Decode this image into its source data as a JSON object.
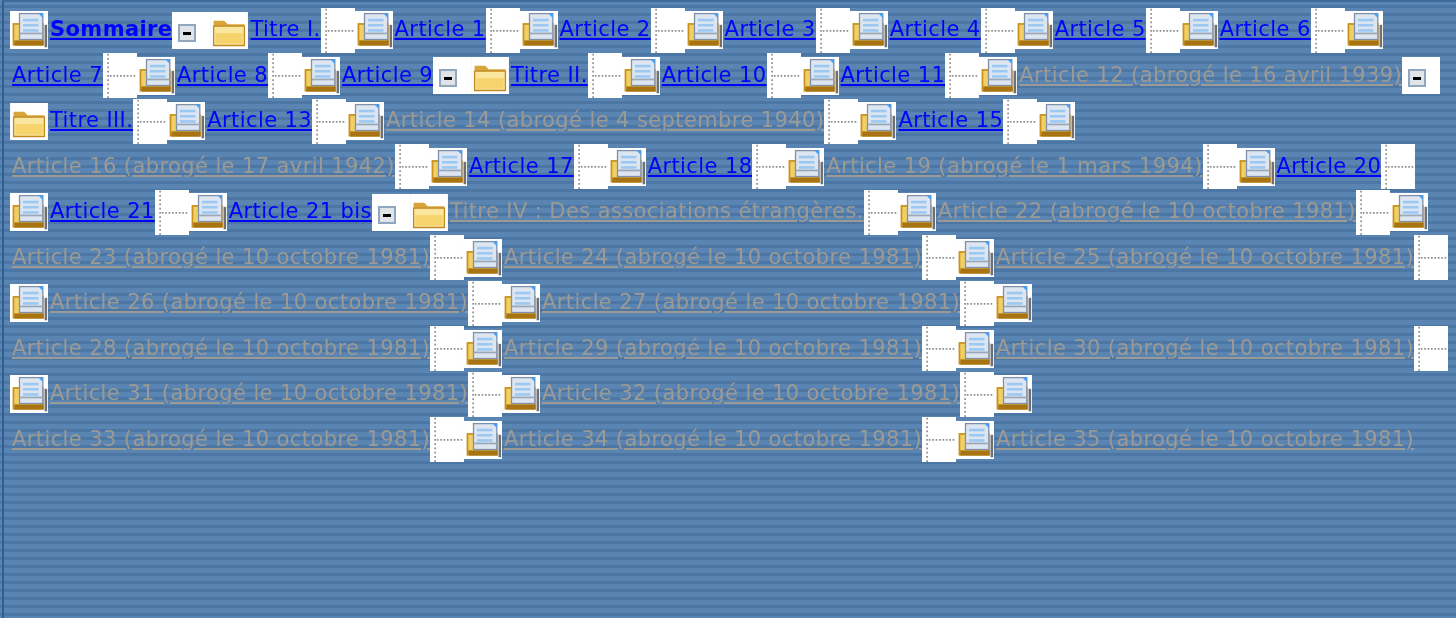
{
  "tree": [
    {
      "kind": "summary",
      "label": "Sommaire",
      "repealed": false
    },
    {
      "kind": "title",
      "label": "Titre I.",
      "repealed": false,
      "expanded": true,
      "children": [
        {
          "kind": "article",
          "label": "Article 1",
          "repealed": false
        },
        {
          "kind": "article",
          "label": "Article 2",
          "repealed": false
        },
        {
          "kind": "article",
          "label": "Article 3",
          "repealed": false
        },
        {
          "kind": "article",
          "label": "Article 4",
          "repealed": false
        },
        {
          "kind": "article",
          "label": "Article 5",
          "repealed": false
        },
        {
          "kind": "article",
          "label": "Article 6",
          "repealed": false
        },
        {
          "kind": "article",
          "label": "Article 7",
          "repealed": false
        },
        {
          "kind": "article",
          "label": "Article 8",
          "repealed": false
        },
        {
          "kind": "article",
          "label": "Article 9",
          "repealed": false
        }
      ]
    },
    {
      "kind": "title",
      "label": "Titre II.",
      "repealed": false,
      "expanded": true,
      "children": [
        {
          "kind": "article",
          "label": "Article 10",
          "repealed": false
        },
        {
          "kind": "article",
          "label": "Article 11",
          "repealed": false
        },
        {
          "kind": "article",
          "label": "Article 12 (abrogé le 16 avril 1939)",
          "repealed": true
        }
      ]
    },
    {
      "kind": "title",
      "label": "Titre III.",
      "repealed": false,
      "expanded": true,
      "children": [
        {
          "kind": "article",
          "label": "Article 13",
          "repealed": false
        },
        {
          "kind": "article",
          "label": "Article 14 (abrogé le 4 septembre 1940)",
          "repealed": true
        },
        {
          "kind": "article",
          "label": "Article 15",
          "repealed": false
        },
        {
          "kind": "article",
          "label": "Article 16 (abrogé le 17 avril 1942)",
          "repealed": true
        },
        {
          "kind": "article",
          "label": "Article 17",
          "repealed": false
        },
        {
          "kind": "article",
          "label": "Article 18",
          "repealed": false
        },
        {
          "kind": "article",
          "label": "Article 19 (abrogé le 1 mars 1994)",
          "repealed": true
        },
        {
          "kind": "article",
          "label": "Article 20",
          "repealed": false
        },
        {
          "kind": "article",
          "label": "Article 21",
          "repealed": false
        },
        {
          "kind": "article",
          "label": "Article 21 bis",
          "repealed": false
        }
      ]
    },
    {
      "kind": "title",
      "label": "Titre IV : Des associations étrangères.",
      "repealed": true,
      "expanded": true,
      "children": [
        {
          "kind": "article",
          "label": "Article 22 (abrogé le 10 octobre 1981)",
          "repealed": true
        },
        {
          "kind": "article",
          "label": "Article 23 (abrogé le 10 octobre 1981)",
          "repealed": true
        },
        {
          "kind": "article",
          "label": "Article 24 (abrogé le 10 octobre 1981)",
          "repealed": true
        },
        {
          "kind": "article",
          "label": "Article 25 (abrogé le 10 octobre 1981)",
          "repealed": true
        },
        {
          "kind": "article",
          "label": "Article 26 (abrogé le 10 octobre 1981)",
          "repealed": true
        },
        {
          "kind": "article",
          "label": "Article 27 (abrogé le 10 octobre 1981)",
          "repealed": true
        },
        {
          "kind": "article",
          "label": "Article 28 (abrogé le 10 octobre 1981)",
          "repealed": true
        },
        {
          "kind": "article",
          "label": "Article 29 (abrogé le 10 octobre 1981)",
          "repealed": true
        },
        {
          "kind": "article",
          "label": "Article 30 (abrogé le 10 octobre 1981)",
          "repealed": true
        },
        {
          "kind": "article",
          "label": "Article 31 (abrogé le 10 octobre 1981)",
          "repealed": true
        },
        {
          "kind": "article",
          "label": "Article 32 (abrogé le 10 octobre 1981)",
          "repealed": true
        },
        {
          "kind": "article",
          "label": "Article 33 (abrogé le 10 octobre 1981)",
          "repealed": true
        },
        {
          "kind": "article",
          "label": "Article 34 (abrogé le 10 octobre 1981)",
          "repealed": true
        },
        {
          "kind": "article",
          "label": "Article 35 (abrogé le 10 octobre 1981)",
          "repealed": true
        }
      ]
    }
  ]
}
